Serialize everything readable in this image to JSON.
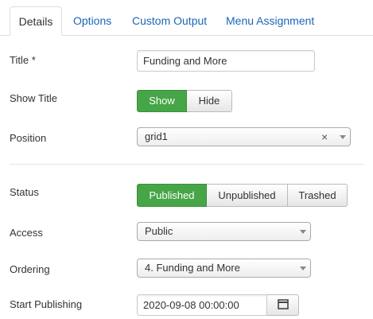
{
  "tabs": [
    {
      "label": "Details",
      "active": true
    },
    {
      "label": "Options",
      "active": false
    },
    {
      "label": "Custom Output",
      "active": false
    },
    {
      "label": "Menu Assignment",
      "active": false
    }
  ],
  "fields": {
    "title": {
      "label": "Title *",
      "value": "Funding and More"
    },
    "show_title": {
      "label": "Show Title",
      "options": [
        "Show",
        "Hide"
      ],
      "selected": "Show"
    },
    "position": {
      "label": "Position",
      "value": "grid1"
    },
    "status": {
      "label": "Status",
      "options": [
        "Published",
        "Unpublished",
        "Trashed"
      ],
      "selected": "Published"
    },
    "access": {
      "label": "Access",
      "value": "Public"
    },
    "ordering": {
      "label": "Ordering",
      "value": "4. Funding and More"
    },
    "start_publishing": {
      "label": "Start Publishing",
      "value": "2020-09-08 00:00:00"
    }
  },
  "colors": {
    "accent_green": "#46a546",
    "link_blue": "#1a66b8"
  },
  "icons": {
    "clear": "close-icon",
    "dropdown": "chevron-down-icon",
    "calendar": "calendar-icon"
  }
}
